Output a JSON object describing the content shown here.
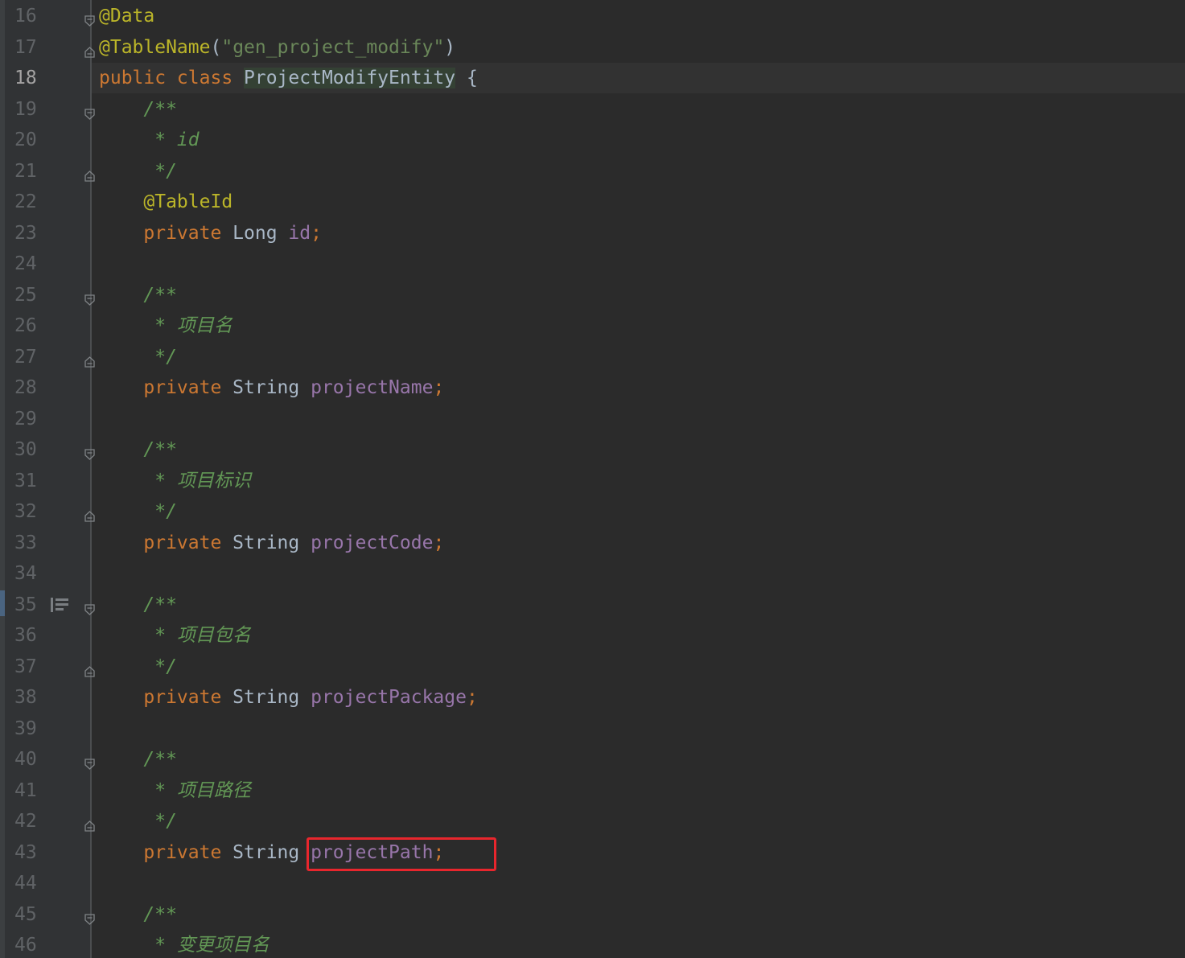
{
  "editor": {
    "current_line": "18",
    "lines": [
      {
        "n": "16",
        "fold": "start",
        "tokens": [
          {
            "t": "@Data",
            "c": "ann"
          }
        ]
      },
      {
        "n": "17",
        "fold": "end",
        "tokens": [
          {
            "t": "@TableName",
            "c": "ann"
          },
          {
            "t": "(",
            "c": "plain"
          },
          {
            "t": "\"gen_project_modify\"",
            "c": "str"
          },
          {
            "t": ")",
            "c": "plain"
          }
        ]
      },
      {
        "n": "18",
        "tokens": [
          {
            "t": "public class ",
            "c": "kw"
          },
          {
            "t": "ProjectModifyEntity",
            "c": "plain cls-hl"
          },
          {
            "t": " {",
            "c": "plain"
          }
        ]
      },
      {
        "n": "19",
        "fold": "start",
        "tokens": [
          {
            "t": "    /**",
            "c": "doc"
          }
        ]
      },
      {
        "n": "20",
        "tokens": [
          {
            "t": "     * id",
            "c": "doc"
          }
        ]
      },
      {
        "n": "21",
        "fold": "end",
        "tokens": [
          {
            "t": "     */",
            "c": "doc"
          }
        ]
      },
      {
        "n": "22",
        "tokens": [
          {
            "t": "    ",
            "c": "plain"
          },
          {
            "t": "@TableId",
            "c": "ann"
          }
        ]
      },
      {
        "n": "23",
        "tokens": [
          {
            "t": "    private ",
            "c": "kw"
          },
          {
            "t": "Long ",
            "c": "plain"
          },
          {
            "t": "id",
            "c": "fld"
          },
          {
            "t": ";",
            "c": "kw"
          }
        ]
      },
      {
        "n": "24",
        "tokens": []
      },
      {
        "n": "25",
        "fold": "start",
        "tokens": [
          {
            "t": "    /**",
            "c": "doc"
          }
        ]
      },
      {
        "n": "26",
        "tokens": [
          {
            "t": "     * 项目名",
            "c": "doc"
          }
        ]
      },
      {
        "n": "27",
        "fold": "end",
        "tokens": [
          {
            "t": "     */",
            "c": "doc"
          }
        ]
      },
      {
        "n": "28",
        "tokens": [
          {
            "t": "    private ",
            "c": "kw"
          },
          {
            "t": "String ",
            "c": "plain"
          },
          {
            "t": "projectName",
            "c": "fld"
          },
          {
            "t": ";",
            "c": "kw"
          }
        ]
      },
      {
        "n": "29",
        "tokens": []
      },
      {
        "n": "30",
        "fold": "start",
        "tokens": [
          {
            "t": "    /**",
            "c": "doc"
          }
        ]
      },
      {
        "n": "31",
        "tokens": [
          {
            "t": "     * 项目标识",
            "c": "doc"
          }
        ]
      },
      {
        "n": "32",
        "fold": "end",
        "tokens": [
          {
            "t": "     */",
            "c": "doc"
          }
        ]
      },
      {
        "n": "33",
        "tokens": [
          {
            "t": "    private ",
            "c": "kw"
          },
          {
            "t": "String ",
            "c": "plain"
          },
          {
            "t": "projectCode",
            "c": "fld"
          },
          {
            "t": ";",
            "c": "kw"
          }
        ]
      },
      {
        "n": "34",
        "tokens": []
      },
      {
        "n": "35",
        "fold": "start",
        "doc_icon": true,
        "tokens": [
          {
            "t": "    /**",
            "c": "doc"
          }
        ]
      },
      {
        "n": "36",
        "tokens": [
          {
            "t": "     * 项目包名",
            "c": "doc"
          }
        ]
      },
      {
        "n": "37",
        "fold": "end",
        "tokens": [
          {
            "t": "     */",
            "c": "doc"
          }
        ]
      },
      {
        "n": "38",
        "tokens": [
          {
            "t": "    private ",
            "c": "kw"
          },
          {
            "t": "String ",
            "c": "plain"
          },
          {
            "t": "projectPackage",
            "c": "fld"
          },
          {
            "t": ";",
            "c": "kw"
          }
        ]
      },
      {
        "n": "39",
        "tokens": []
      },
      {
        "n": "40",
        "fold": "start",
        "tokens": [
          {
            "t": "    /**",
            "c": "doc"
          }
        ]
      },
      {
        "n": "41",
        "tokens": [
          {
            "t": "     * 项目路径",
            "c": "doc"
          }
        ]
      },
      {
        "n": "42",
        "fold": "end",
        "tokens": [
          {
            "t": "     */",
            "c": "doc"
          }
        ]
      },
      {
        "n": "43",
        "tokens": [
          {
            "t": "    private ",
            "c": "kw"
          },
          {
            "t": "String ",
            "c": "plain"
          },
          {
            "t": "projectPath",
            "c": "fld"
          },
          {
            "t": ";",
            "c": "kw"
          }
        ]
      },
      {
        "n": "44",
        "tokens": []
      },
      {
        "n": "45",
        "fold": "start",
        "tokens": [
          {
            "t": "    /**",
            "c": "doc"
          }
        ]
      },
      {
        "n": "46",
        "tokens": [
          {
            "t": "     * 变更项目名",
            "c": "doc"
          }
        ]
      }
    ]
  },
  "colors": {
    "background": "#2b2b2b",
    "gutter": "#313335",
    "keyword": "#cc7832",
    "annotation": "#bbb529",
    "string": "#6a8759",
    "field": "#9876aa",
    "doc_comment": "#629755",
    "highlight_box": "#e8262d"
  }
}
